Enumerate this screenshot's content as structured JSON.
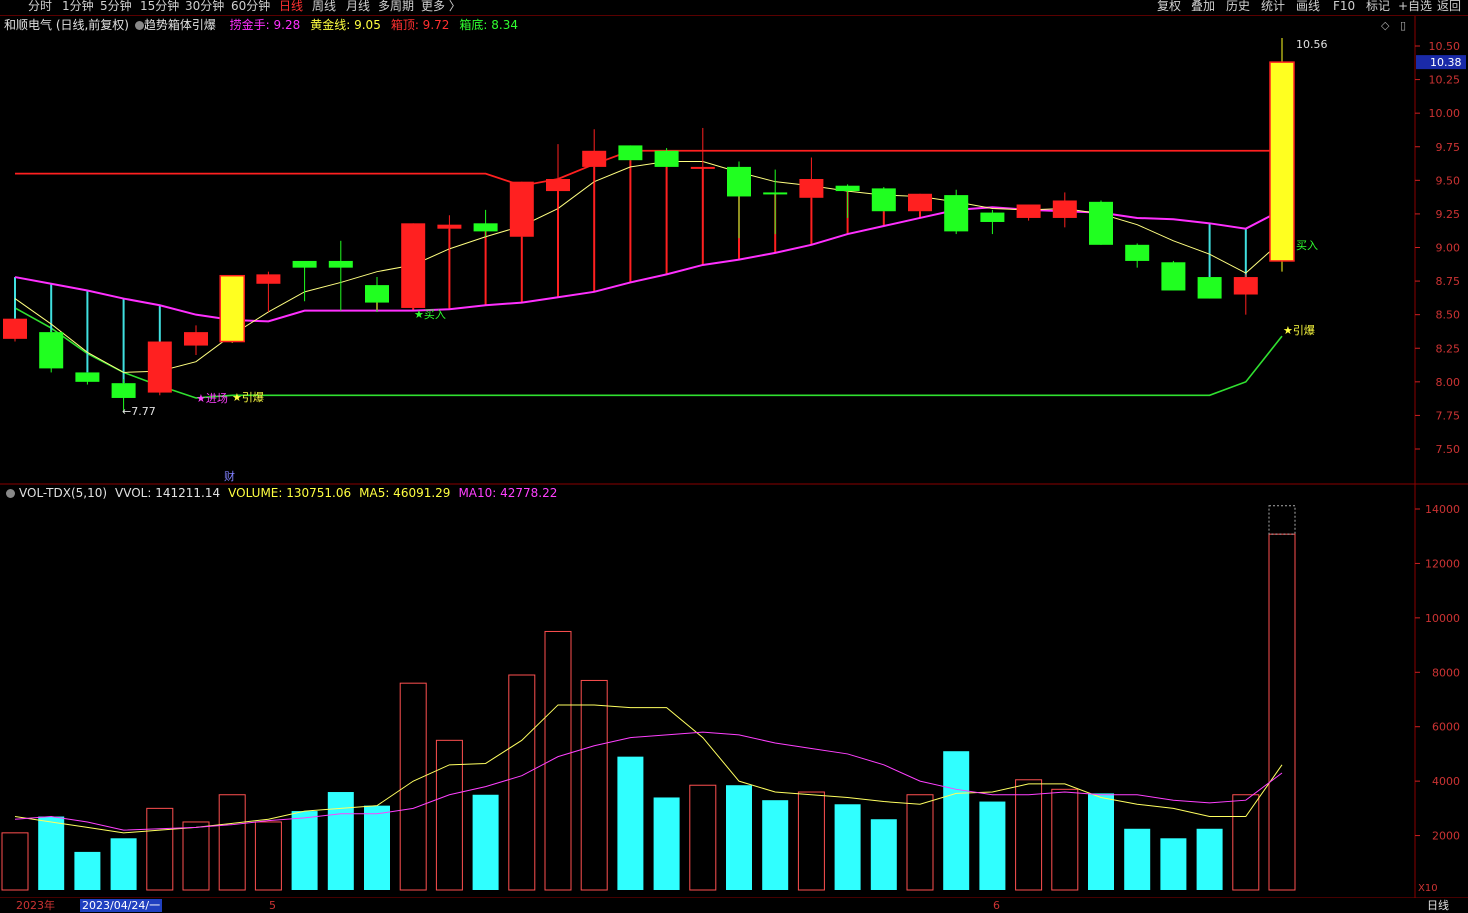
{
  "toolbar": {
    "periods": [
      {
        "label": "分时",
        "active": false
      },
      {
        "label": "1分钟",
        "active": false
      },
      {
        "label": "5分钟",
        "active": false
      },
      {
        "label": "15分钟",
        "active": false
      },
      {
        "label": "30分钟",
        "active": false
      },
      {
        "label": "60分钟",
        "active": false
      },
      {
        "label": "日线",
        "active": true
      },
      {
        "label": "周线",
        "active": false
      },
      {
        "label": "月线",
        "active": false
      },
      {
        "label": "多周期",
        "active": false
      },
      {
        "label": "更多 〉",
        "active": false
      }
    ],
    "actions": [
      "复权",
      "叠加",
      "历史",
      "统计",
      "画线",
      "F10",
      "标记",
      "+自选",
      "返回"
    ]
  },
  "header": {
    "stock": "和顺电气 (日线,前复权)",
    "indicator": "趋势箱体引爆",
    "params": [
      {
        "label": "捞金手: 9.28",
        "color": "#ff30ff"
      },
      {
        "label": "黄金线: 9.05",
        "color": "#ffff40"
      },
      {
        "label": "箱顶: 9.72",
        "color": "#ff3030"
      },
      {
        "label": "箱底: 8.34",
        "color": "#30ff30"
      }
    ]
  },
  "volume_header": {
    "name": "VOL-TDX(5,10)",
    "items": [
      {
        "label": "VVOL: 141211.14",
        "color": "#e0e0e0"
      },
      {
        "label": "VOLUME: 130751.06",
        "color": "#ffff40"
      },
      {
        "label": "MA5: 46091.29",
        "color": "#ffff40"
      },
      {
        "label": "MA10: 42778.22",
        "color": "#ff40ff"
      }
    ]
  },
  "price_badge": "10.38",
  "price_ticks": [
    "10.50",
    "10.25",
    "10.00",
    "9.75",
    "9.50",
    "9.25",
    "9.00",
    "8.75",
    "8.50",
    "8.25",
    "8.00",
    "7.75",
    "7.50"
  ],
  "volume_ticks": [
    "14000",
    "12000",
    "10000",
    "8000",
    "6000",
    "4000",
    "2000"
  ],
  "volume_unit": "X10",
  "annotations": {
    "low": "←7.77",
    "high": "10.56",
    "buy1": "★买入",
    "buy2": "买入",
    "entry": "★进场",
    "ignite1": "★引爆",
    "ignite2": "★引爆",
    "cai": "财"
  },
  "bottom_labels": {
    "year": "2023年",
    "date": "2023/04/24/一",
    "m5": "5",
    "m6": "6",
    "period": "日线"
  },
  "chart_data": [
    {
      "type": "candlestick",
      "name": "price",
      "ylim": [
        7.3,
        10.6
      ],
      "candles": [
        {
          "o": 8.32,
          "h": 8.45,
          "l": 8.3,
          "c": 8.47
        },
        {
          "o": 8.37,
          "h": 8.39,
          "l": 8.07,
          "c": 8.1
        },
        {
          "o": 8.07,
          "h": 8.07,
          "l": 7.98,
          "c": 8.0
        },
        {
          "o": 7.99,
          "h": 8.02,
          "l": 7.77,
          "c": 7.88
        },
        {
          "o": 7.92,
          "h": 8.3,
          "l": 7.9,
          "c": 8.3
        },
        {
          "o": 8.27,
          "h": 8.42,
          "l": 8.2,
          "c": 8.37
        },
        {
          "o": 8.3,
          "h": 8.79,
          "l": 8.29,
          "c": 8.79
        },
        {
          "o": 8.73,
          "h": 8.82,
          "l": 8.52,
          "c": 8.8
        },
        {
          "o": 8.9,
          "h": 8.89,
          "l": 8.6,
          "c": 8.85
        },
        {
          "o": 8.9,
          "h": 9.05,
          "l": 8.53,
          "c": 8.85
        },
        {
          "o": 8.72,
          "h": 8.78,
          "l": 8.52,
          "c": 8.59
        },
        {
          "o": 8.55,
          "h": 9.18,
          "l": 8.55,
          "c": 9.18
        },
        {
          "o": 9.14,
          "h": 9.24,
          "l": 8.68,
          "c": 9.17
        },
        {
          "o": 9.18,
          "h": 9.28,
          "l": 9.08,
          "c": 9.12
        },
        {
          "o": 9.08,
          "h": 9.49,
          "l": 8.82,
          "c": 9.49
        },
        {
          "o": 9.42,
          "h": 9.77,
          "l": 8.82,
          "c": 9.51
        },
        {
          "o": 9.6,
          "h": 9.88,
          "l": 8.83,
          "c": 9.72
        },
        {
          "o": 9.76,
          "h": 9.76,
          "l": 9.65,
          "c": 9.65
        },
        {
          "o": 9.72,
          "h": 9.74,
          "l": 9.6,
          "c": 9.6
        },
        {
          "o": 9.59,
          "h": 9.89,
          "l": 9.0,
          "c": 9.6
        },
        {
          "o": 9.6,
          "h": 9.64,
          "l": 9.07,
          "c": 9.38
        },
        {
          "o": 9.41,
          "h": 9.58,
          "l": 9.1,
          "c": 9.4
        },
        {
          "o": 9.37,
          "h": 9.67,
          "l": 9.2,
          "c": 9.51
        },
        {
          "o": 9.46,
          "h": 9.47,
          "l": 9.22,
          "c": 9.42
        },
        {
          "o": 9.44,
          "h": 9.45,
          "l": 9.27,
          "c": 9.27
        },
        {
          "o": 9.27,
          "h": 9.4,
          "l": 9.27,
          "c": 9.4
        },
        {
          "o": 9.39,
          "h": 9.43,
          "l": 9.1,
          "c": 9.12
        },
        {
          "o": 9.26,
          "h": 9.28,
          "l": 9.1,
          "c": 9.19
        },
        {
          "o": 9.22,
          "h": 9.32,
          "l": 9.2,
          "c": 9.32
        },
        {
          "o": 9.22,
          "h": 9.41,
          "l": 9.15,
          "c": 9.35
        },
        {
          "o": 9.34,
          "h": 9.35,
          "l": 9.02,
          "c": 9.02
        },
        {
          "o": 9.02,
          "h": 9.03,
          "l": 8.85,
          "c": 8.9
        },
        {
          "o": 8.89,
          "h": 8.9,
          "l": 8.68,
          "c": 8.68
        },
        {
          "o": 8.78,
          "h": 8.77,
          "l": 8.62,
          "c": 8.62
        },
        {
          "o": 8.65,
          "h": 8.8,
          "l": 8.5,
          "c": 8.78
        },
        {
          "o": 8.9,
          "h": 10.56,
          "l": 8.82,
          "c": 10.38
        }
      ],
      "series": [
        {
          "name": "捞金手",
          "values": [
            8.78,
            8.73,
            8.68,
            8.62,
            8.57,
            8.5,
            8.46,
            8.45,
            8.53,
            8.53,
            8.53,
            8.53,
            8.54,
            8.57,
            8.59,
            8.63,
            8.67,
            8.74,
            8.8,
            8.87,
            8.91,
            8.96,
            9.02,
            9.1,
            9.16,
            9.22,
            9.28,
            9.3,
            9.28,
            9.27,
            9.26,
            9.22,
            9.21,
            9.18,
            9.14,
            9.28
          ]
        },
        {
          "name": "黄金线",
          "values": [
            8.62,
            8.43,
            8.22,
            8.07,
            8.08,
            8.15,
            8.35,
            8.52,
            8.67,
            8.74,
            8.82,
            8.87,
            8.99,
            9.08,
            9.16,
            9.29,
            9.49,
            9.6,
            9.64,
            9.64,
            9.56,
            9.49,
            9.46,
            9.42,
            9.39,
            9.38,
            9.34,
            9.29,
            9.28,
            9.29,
            9.25,
            9.17,
            9.05,
            8.95,
            8.81,
            9.05
          ]
        },
        {
          "name": "箱顶",
          "values": [
            9.55,
            9.55,
            9.55,
            9.55,
            9.55,
            9.55,
            9.55,
            9.55,
            9.55,
            9.55,
            9.55,
            9.55,
            9.55,
            9.55,
            9.46,
            9.51,
            9.62,
            9.72,
            9.72,
            9.72,
            9.72,
            9.72,
            9.72,
            9.72,
            9.72,
            9.72,
            9.72,
            9.72,
            9.72,
            9.72,
            9.72,
            9.72,
            9.72,
            9.72,
            9.72,
            9.72
          ]
        },
        {
          "name": "箱底",
          "values": [
            8.55,
            8.4,
            8.21,
            8.07,
            7.97,
            7.88,
            7.9,
            7.9,
            7.9,
            7.9,
            7.9,
            7.9,
            7.9,
            7.9,
            7.9,
            7.9,
            7.9,
            7.9,
            7.9,
            7.9,
            7.9,
            7.9,
            7.9,
            7.9,
            7.9,
            7.9,
            7.9,
            7.9,
            7.9,
            7.9,
            7.9,
            7.9,
            7.9,
            7.9,
            8.0,
            8.34
          ]
        }
      ]
    },
    {
      "type": "bar",
      "name": "volume",
      "ylabel": "",
      "ylim": [
        0,
        14000
      ],
      "values": [
        2100,
        2700,
        1400,
        1900,
        3000,
        2500,
        3500,
        2500,
        2900,
        3600,
        3100,
        7600,
        5500,
        3500,
        7900,
        9500,
        7700,
        4900,
        3400,
        3850,
        3850,
        3300,
        3600,
        3150,
        2600,
        3500,
        5100,
        3250,
        4050,
        3700,
        3550,
        2250,
        1900,
        2250,
        3500,
        13075
      ],
      "ma5": [
        2700,
        2500,
        2300,
        2100,
        2200,
        2300,
        2450,
        2600,
        2900,
        3000,
        3100,
        4000,
        4600,
        4650,
        5500,
        6800,
        6800,
        6700,
        6700,
        5600,
        4000,
        3600,
        3500,
        3400,
        3250,
        3150,
        3550,
        3600,
        3900,
        3900,
        3400,
        3150,
        3000,
        2700,
        2700,
        4600
      ],
      "ma10": [
        2600,
        2700,
        2500,
        2200,
        2250,
        2300,
        2400,
        2550,
        2650,
        2800,
        2800,
        3000,
        3500,
        3800,
        4200,
        4900,
        5300,
        5600,
        5700,
        5800,
        5700,
        5400,
        5200,
        5000,
        4600,
        4000,
        3700,
        3500,
        3500,
        3600,
        3500,
        3500,
        3300,
        3200,
        3300,
        4300
      ]
    }
  ]
}
